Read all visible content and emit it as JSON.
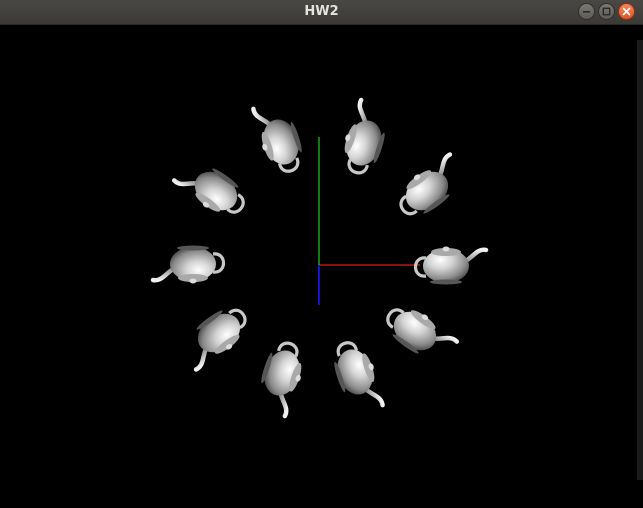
{
  "window": {
    "title": "HW2",
    "controls": {
      "minimize_icon": "minimize-icon",
      "maximize_icon": "maximize-icon",
      "close_icon": "close-icon"
    }
  },
  "scene": {
    "background": "#000000",
    "axes": {
      "x_color": "#e01818",
      "y_color": "#18c018",
      "z_color": "#1a1aff"
    },
    "object": "teapot",
    "teapot_count": 10
  }
}
